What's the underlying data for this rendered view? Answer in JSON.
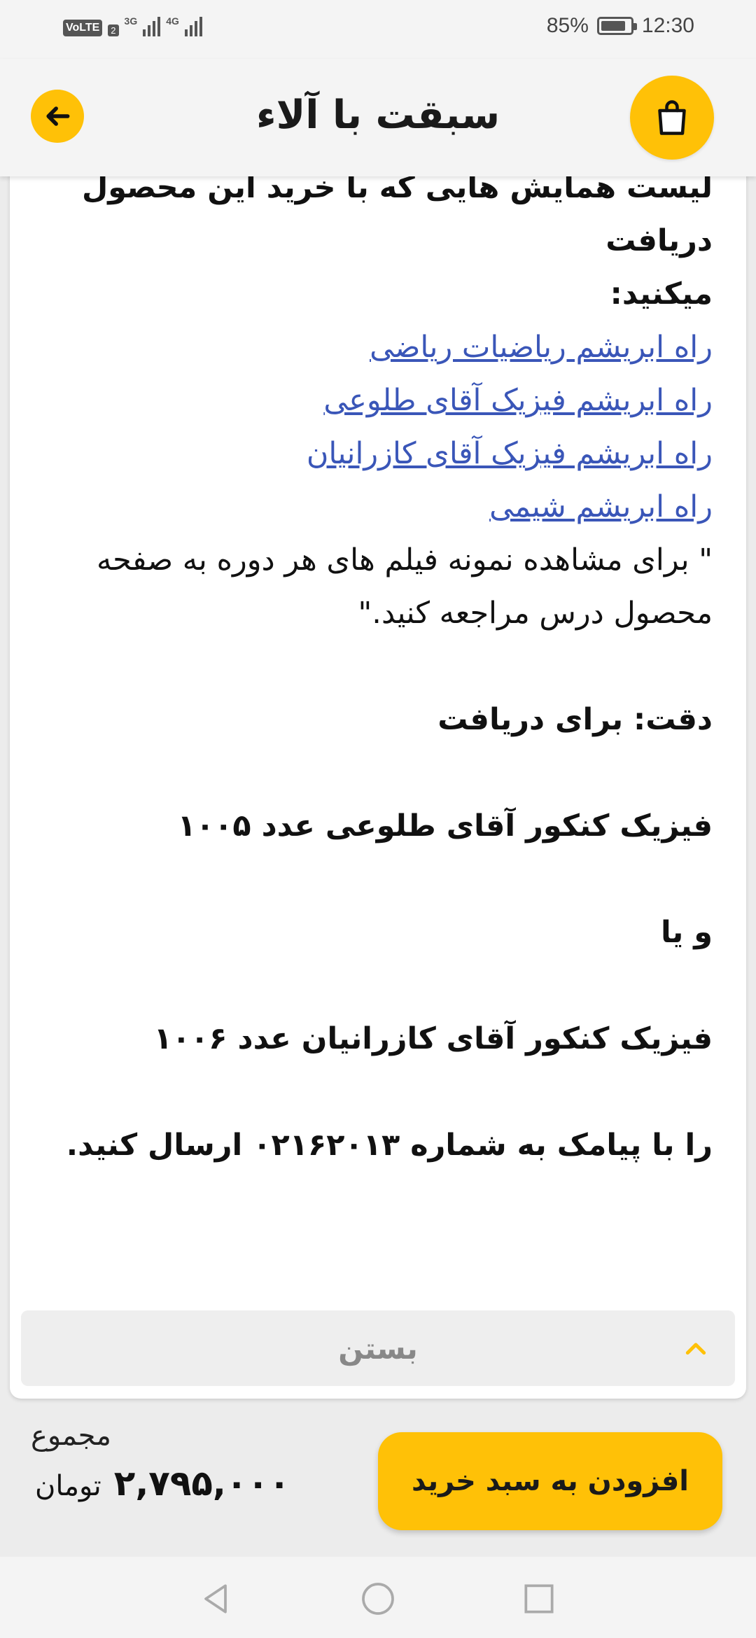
{
  "status_bar": {
    "volte": "VoLTE",
    "sim_slot": "2",
    "network_1": "3G",
    "network_2": "4G",
    "battery_percent": "85%",
    "battery_level": 0.85,
    "time": "12:30"
  },
  "header": {
    "title": "سبقت با آلاء",
    "back_icon": "arrow-left-icon",
    "cart_icon": "shopping-bag-icon",
    "accent_color": "#ffc107"
  },
  "content": {
    "intro_line1": "لیست همایش هایی که با خرید این محصول دریافت",
    "intro_line2": "میکنید:",
    "links": [
      "راه ابریشم ریاضیات ریاضی",
      "راه ابریشم فیزیک آقای طلوعی",
      "راه ابریشم فیزیک آقای کازرانیان",
      "راه ابریشم شیمی"
    ],
    "note_line1": "\" برای مشاهده نمونه فیلم های هر دوره به صفحه",
    "note_line2": "محصول درس مراجعه کنید.\"",
    "attention": "دقت: برای دریافت",
    "option1": "فیزیک کنکور  آقای طلوعی عدد ۱۰۰۵",
    "or": "و یا",
    "option2": "فیزیک کنکور آقای کازرانیان عدد ۱۰۰۶",
    "sms_line": "را با پیامک به شماره ۰۲۱۶۲۰۱۳ ارسال کنید."
  },
  "collapse": {
    "label": "بستن",
    "icon": "chevron-up-icon"
  },
  "footer": {
    "total_label": "مجموع",
    "total_amount": "۲,۷۹۵,۰۰۰",
    "currency": "تومان",
    "add_to_cart": "افزودن به سبد خرید"
  },
  "nav": {
    "back": "nav-back-icon",
    "home": "nav-home-icon",
    "recent": "nav-recent-icon"
  }
}
